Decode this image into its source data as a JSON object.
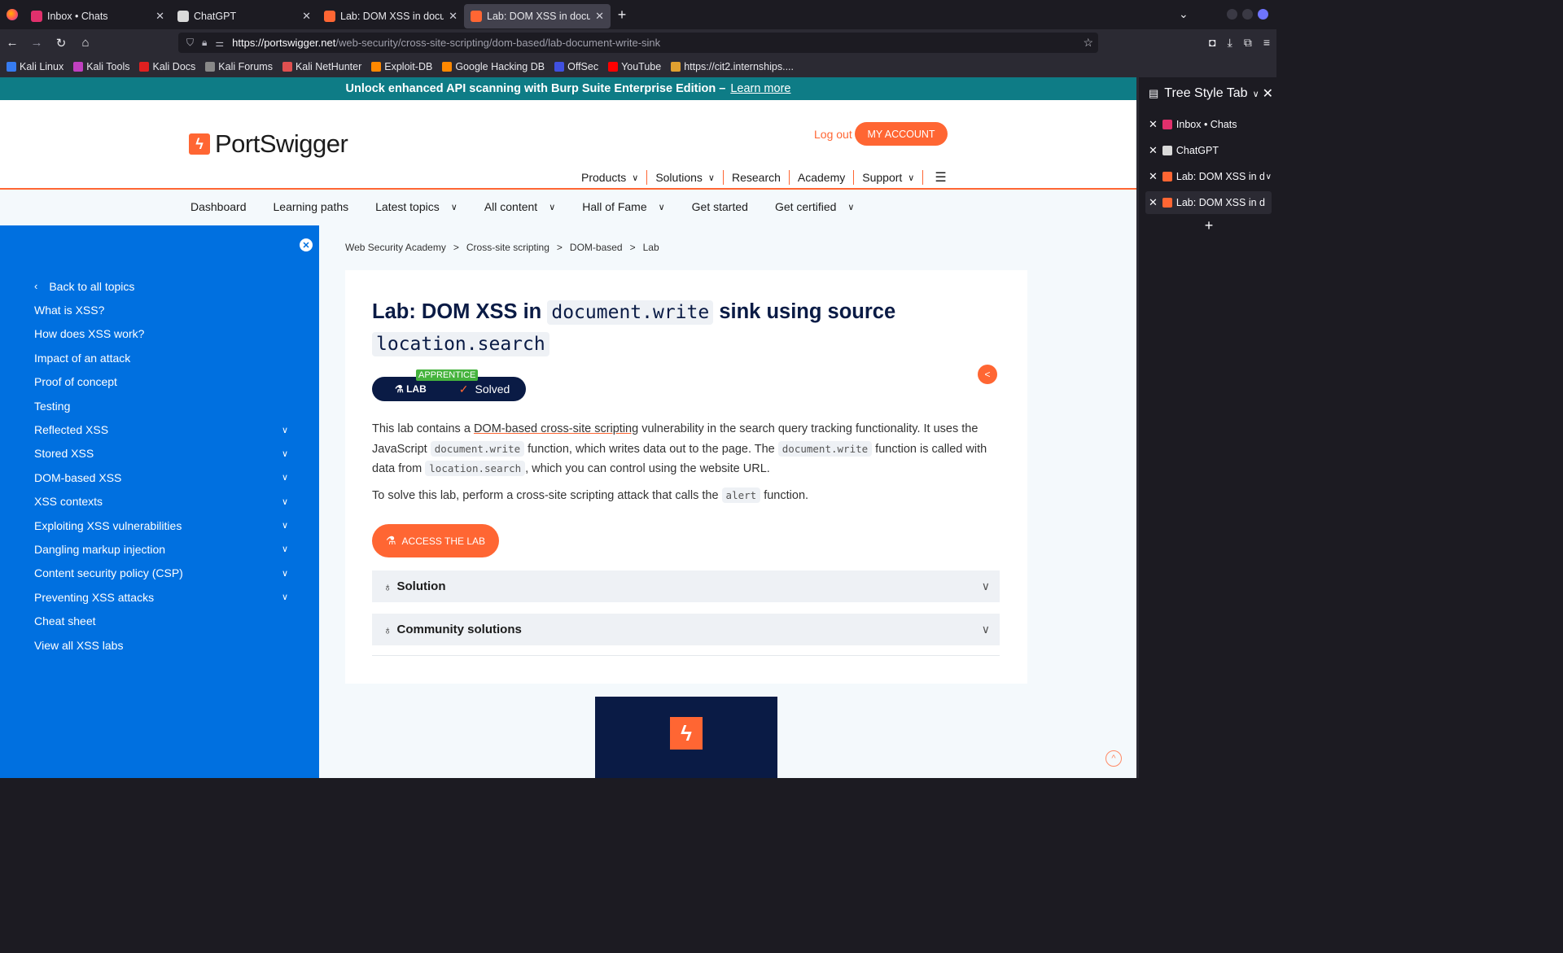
{
  "browser": {
    "tabs": [
      {
        "label": "Inbox • Chats",
        "fav_color": "#e1306c",
        "active": false
      },
      {
        "label": "ChatGPT",
        "fav_color": "#d9d9d9",
        "active": false
      },
      {
        "label": "Lab: DOM XSS in docume",
        "fav_color": "#ff6633",
        "active": false
      },
      {
        "label": "Lab: DOM XSS in docume",
        "fav_color": "#ff6633",
        "active": true
      }
    ],
    "url_host": "https://portswigger.net",
    "url_path": "/web-security/cross-site-scripting/dom-based/lab-document-write-sink",
    "bookmarks": [
      {
        "label": "Kali Linux",
        "color": "#367bf0"
      },
      {
        "label": "Kali Tools",
        "color": "#c040c0"
      },
      {
        "label": "Kali Docs",
        "color": "#e02020"
      },
      {
        "label": "Kali Forums",
        "color": "#888888"
      },
      {
        "label": "Kali NetHunter",
        "color": "#e05050"
      },
      {
        "label": "Exploit-DB",
        "color": "#ff8800"
      },
      {
        "label": "Google Hacking DB",
        "color": "#ff8800"
      },
      {
        "label": "OffSec",
        "color": "#4050e0"
      },
      {
        "label": "YouTube",
        "color": "#ff0000"
      },
      {
        "label": "https://cit2.internships....",
        "color": "#e0a030"
      }
    ]
  },
  "site": {
    "banner_text": "Unlock enhanced API scanning with Burp Suite Enterprise Edition",
    "banner_dash": "–",
    "banner_link": "Learn more",
    "logo_text": "PortSwigger",
    "logout": "Log out",
    "my_account": "MY ACCOUNT",
    "main_nav": [
      "Products",
      "Solutions",
      "Research",
      "Academy",
      "Support"
    ],
    "sub_nav": [
      "Dashboard",
      "Learning paths",
      "Latest topics",
      "All content",
      "Hall of Fame",
      "Get started",
      "Get certified"
    ],
    "accent": "#ff6633",
    "sidebar_bg": "#0070e0",
    "navy": "#0a1b45"
  },
  "sidebar": {
    "back": "Back to all topics",
    "items": [
      {
        "label": "What is XSS?",
        "expand": false
      },
      {
        "label": "How does XSS work?",
        "expand": false
      },
      {
        "label": "Impact of an attack",
        "expand": false
      },
      {
        "label": "Proof of concept",
        "expand": false
      },
      {
        "label": "Testing",
        "expand": false
      },
      {
        "label": "Reflected XSS",
        "expand": true
      },
      {
        "label": "Stored XSS",
        "expand": true
      },
      {
        "label": "DOM-based XSS",
        "expand": true
      },
      {
        "label": "XSS contexts",
        "expand": true
      },
      {
        "label": "Exploiting XSS vulnerabilities",
        "expand": true
      },
      {
        "label": "Dangling markup injection",
        "expand": true
      },
      {
        "label": "Content security policy (CSP)",
        "expand": true
      },
      {
        "label": "Preventing XSS attacks",
        "expand": true
      },
      {
        "label": "Cheat sheet",
        "expand": false
      },
      {
        "label": "View all XSS labs",
        "expand": false
      }
    ]
  },
  "breadcrumb": [
    "Web Security Academy",
    "Cross-site scripting",
    "DOM-based",
    "Lab"
  ],
  "lab": {
    "title_1": "Lab: DOM XSS in",
    "title_code_1": "document.write",
    "title_2": "sink using source",
    "title_code_2": "location.search",
    "level": "APPRENTICE",
    "lab_label": "LAB",
    "status": "Solved",
    "desc_1a": "This lab contains a",
    "desc_1_link": "DOM-based cross-site scripting",
    "desc_1b": "vulnerability in the search query tracking functionality. It uses the JavaScript",
    "desc_code_1": "document.write",
    "desc_1c": "function, which writes data out to the page. The",
    "desc_code_2": "document.write",
    "desc_1d": "function is called with data from",
    "desc_code_3": "location.search",
    "desc_1e": ", which you can control using the website URL.",
    "desc_2a": "To solve this lab, perform a cross-site scripting attack that calls the",
    "desc_code_4": "alert",
    "desc_2b": "function.",
    "access_button": "ACCESS THE LAB",
    "solution": "Solution",
    "community": "Community solutions"
  },
  "tree_style_tab": {
    "title": "Tree Style Tab",
    "items": [
      {
        "label": "Inbox • Chats",
        "fav_color": "#e1306c",
        "active": false
      },
      {
        "label": "ChatGPT",
        "fav_color": "#d9d9d9",
        "active": false
      },
      {
        "label": "Lab: DOM XSS in doc",
        "fav_color": "#ff6633",
        "active": false
      },
      {
        "label": "Lab: DOM XSS in d",
        "fav_color": "#ff6633",
        "active": true
      }
    ]
  }
}
